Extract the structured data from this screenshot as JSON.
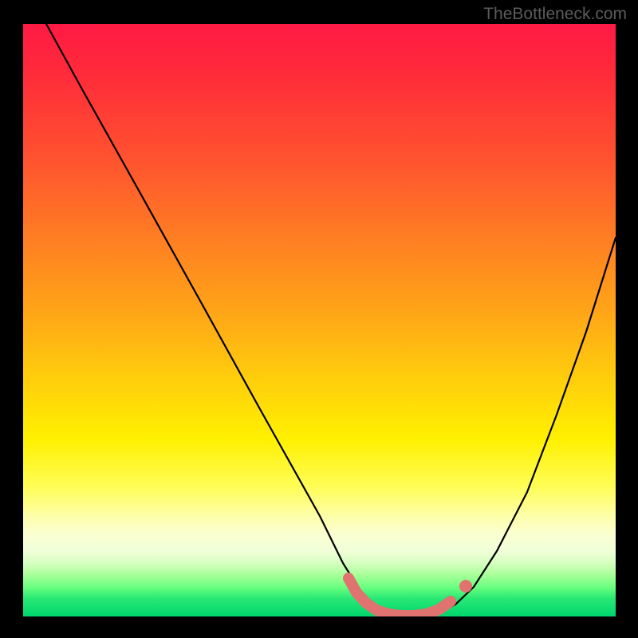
{
  "watermark": "TheBottleneck.com",
  "chart_data": {
    "type": "line",
    "title": "",
    "xlabel": "",
    "ylabel": "",
    "xlim": [
      0,
      100
    ],
    "ylim": [
      0,
      100
    ],
    "series": [
      {
        "name": "curve",
        "x": [
          4,
          10,
          20,
          30,
          40,
          50,
          54,
          57,
          60,
          63,
          65,
          67,
          70,
          73,
          76,
          80,
          85,
          90,
          95,
          100
        ],
        "y": [
          100,
          89,
          71,
          53,
          35,
          17,
          9,
          4,
          1,
          0,
          0,
          0,
          0.5,
          2,
          5,
          11,
          21,
          34,
          48,
          64
        ]
      }
    ],
    "colors": {
      "curve": "#000000",
      "marker_fill": "#e0736f",
      "marker_stroke": "#e0736f",
      "gradient_top": "#ff1a45",
      "gradient_mid": "#fff000",
      "gradient_bottom": "#00d66e"
    }
  }
}
